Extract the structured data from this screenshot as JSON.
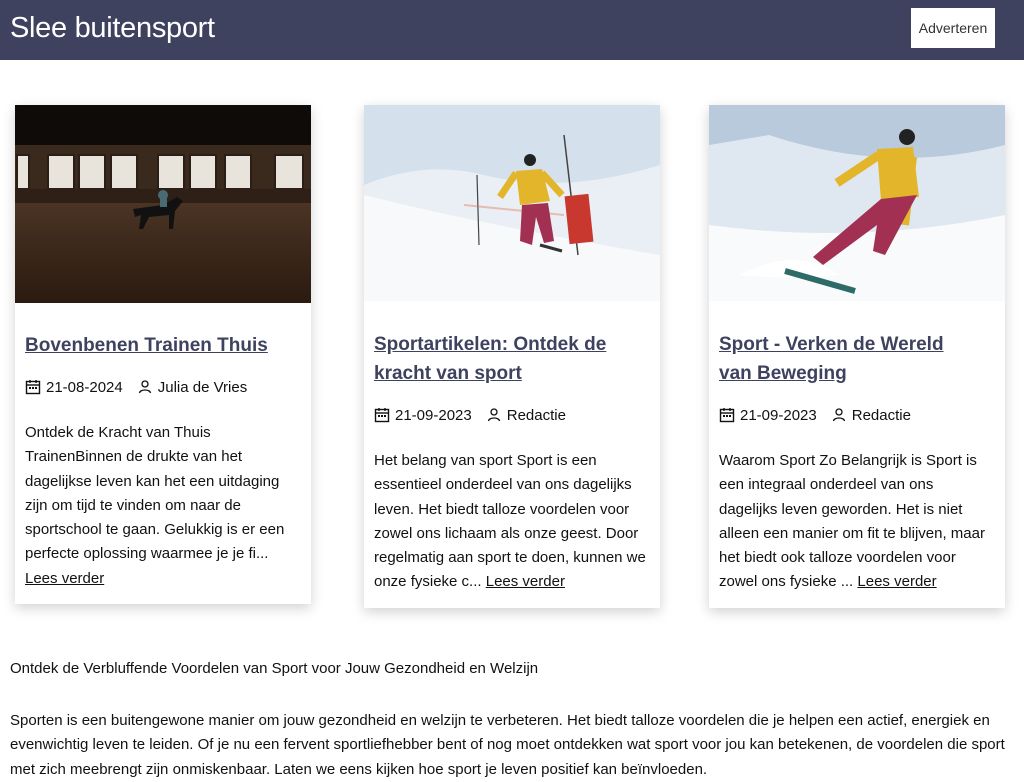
{
  "header": {
    "site_title": "Slee buitensport",
    "ad_button": "Adverteren",
    "bg_color": "#3e425e"
  },
  "cards": [
    {
      "title": "Bovenbenen Trainen Thuis",
      "date": "21-08-2024",
      "author": "Julia de Vries",
      "excerpt": "Ontdek de Kracht van Thuis TrainenBinnen de drukte van het dagelijkse leven kan het een uitdaging zijn om tijd te vinden om naar de sportschool te gaan. Gelukkig is er een perfecte oplossing waarmee je je fi...",
      "read_more": "Lees verder",
      "image": "horse-riding-arena"
    },
    {
      "title": "Sportartikelen: Ontdek de kracht van sport",
      "date": "21-09-2023",
      "author": "Redactie",
      "excerpt": "Het belang van sport Sport is een essentieel onderdeel van ons dagelijks leven. Het biedt talloze voordelen voor zowel ons lichaam als onze geest. Door regelmatig aan sport te doen, kunnen we onze fysieke c...",
      "read_more": "Lees verder",
      "image": "skier-slalom"
    },
    {
      "title": "Sport - Verken de Wereld van Beweging",
      "date": "21-09-2023",
      "author": "Redactie",
      "excerpt": "Waarom Sport Zo Belangrijk is Sport is een integraal onderdeel van ons dagelijks leven geworden. Het is niet alleen een manier om fit te blijven, maar het biedt ook talloze voordelen voor zowel ons fysieke ...",
      "read_more": "Lees verder",
      "image": "snowboarder"
    }
  ],
  "article": {
    "intro": "Ontdek de Verbluffende Voordelen van Sport voor Jouw Gezondheid en Welzijn",
    "paragraph": "Sporten is een buitengewone manier om jouw gezondheid en welzijn te verbeteren. Het biedt talloze voordelen die je helpen een actief, energiek en evenwichtig leven te leiden. Of je nu een fervent sportliefhebber bent of nog moet ontdekken wat sport voor jou kan betekenen, de voordelen die sport met zich meebrengt zijn onmiskenbaar. Laten we eens kijken hoe sport je leven positief kan beïnvloeden."
  },
  "icons": {
    "date": "calendar-icon",
    "author": "user-icon"
  }
}
